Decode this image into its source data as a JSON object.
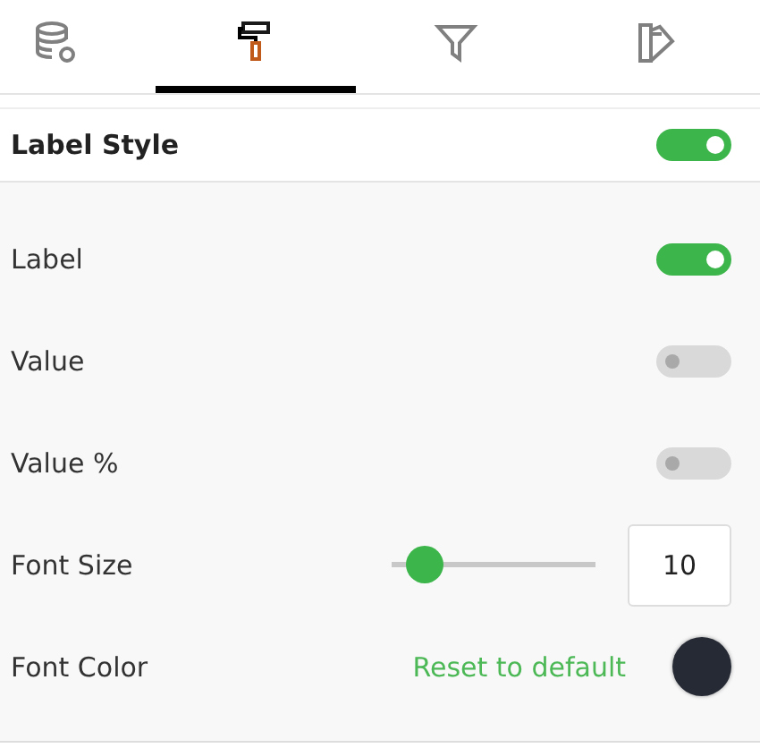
{
  "tabs": [
    {
      "kind": "data",
      "selected": false
    },
    {
      "kind": "format",
      "selected": true
    },
    {
      "kind": "filter",
      "selected": false
    },
    {
      "kind": "palette",
      "selected": false
    }
  ],
  "section": {
    "title": "Label Style",
    "on": true
  },
  "rows": [
    {
      "kind": "toggle",
      "label": "Label",
      "on": true
    },
    {
      "kind": "toggle",
      "label": "Value",
      "on": false
    },
    {
      "kind": "toggle",
      "label": "Value %",
      "on": false
    },
    {
      "kind": "slider",
      "label": "Font Size",
      "level": 0.08,
      "value": "10"
    },
    {
      "kind": "color",
      "label": "Font Color",
      "link": "Reset to default",
      "color": "#252a35"
    }
  ]
}
